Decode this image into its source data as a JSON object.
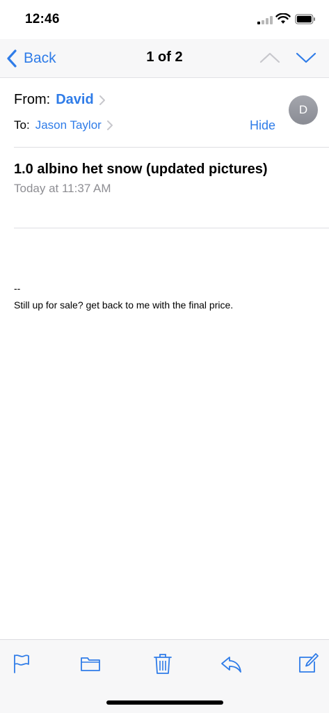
{
  "status_bar": {
    "time": "12:46"
  },
  "nav": {
    "back_label": "Back",
    "title": "1 of 2"
  },
  "header": {
    "from_label": "From:",
    "from_name": "David",
    "to_label": "To:",
    "to_name": "Jason Taylor",
    "hide_label": "Hide",
    "avatar_initial": "D"
  },
  "message": {
    "subject": "1.0 albino het snow (updated pictures)",
    "date": "Today at 11:37 AM",
    "signature_separator": "--",
    "body": "Still up for sale? get back to me with the final price."
  },
  "colors": {
    "accent": "#2f7ce8",
    "secondary_text": "#8e8e93",
    "bar_background": "#f7f7f8"
  },
  "toolbar": {
    "icons": [
      "flag-icon",
      "folder-icon",
      "trash-icon",
      "reply-icon",
      "compose-icon"
    ]
  }
}
